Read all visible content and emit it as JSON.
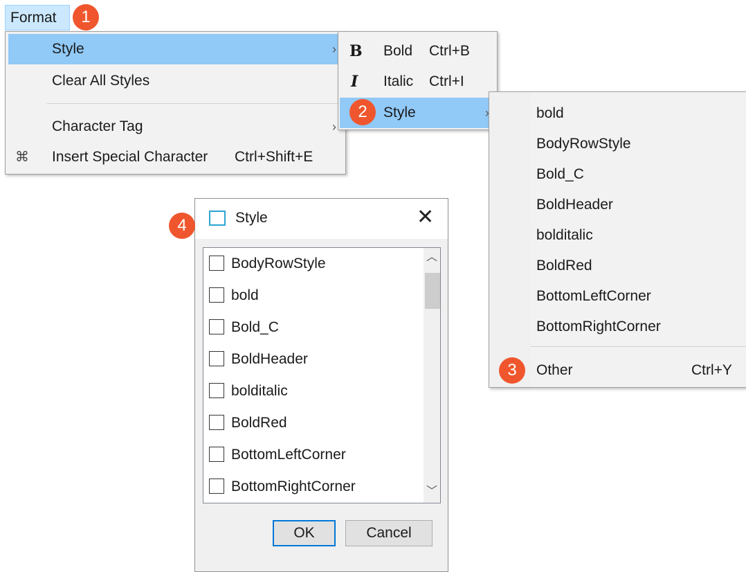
{
  "menubar": {
    "format_label": "Format"
  },
  "callouts": [
    "1",
    "2",
    "3",
    "4"
  ],
  "format_menu": {
    "items": [
      {
        "label": "Style",
        "shortcut": "",
        "submenu": true
      },
      {
        "label": "Clear All Styles",
        "shortcut": "",
        "submenu": false
      },
      {
        "label": "Character Tag",
        "shortcut": "",
        "submenu": true
      },
      {
        "label": "Insert Special Character",
        "shortcut": "Ctrl+Shift+E",
        "submenu": false,
        "icon": "special-character-icon"
      }
    ]
  },
  "style_submenu": {
    "items": [
      {
        "label": "Bold",
        "shortcut": "Ctrl+B",
        "icon": "bold-icon",
        "icon_glyph": "B"
      },
      {
        "label": "Italic",
        "shortcut": "Ctrl+I",
        "icon": "italic-icon",
        "icon_glyph": "I"
      },
      {
        "label": "Style",
        "shortcut": "",
        "submenu": true
      }
    ]
  },
  "styles_menu": {
    "items": [
      "bold",
      "BodyRowStyle",
      "Bold_C",
      "BoldHeader",
      "bolditalic",
      "BoldRed",
      "BottomLeftCorner",
      "BottomRightCorner"
    ],
    "other_label": "Other",
    "other_shortcut": "Ctrl+Y"
  },
  "dialog": {
    "title": "Style",
    "close_glyph": "✕",
    "items": [
      "BodyRowStyle",
      "bold",
      "Bold_C",
      "BoldHeader",
      "bolditalic",
      "BoldRed",
      "BottomLeftCorner",
      "BottomRightCorner"
    ],
    "ok_label": "OK",
    "cancel_label": "Cancel"
  },
  "colors": {
    "callout": "#f0562d",
    "highlight": "#91c9f7",
    "menubar_active": "#cce8ff",
    "dialog_accent": "#0078d7"
  }
}
